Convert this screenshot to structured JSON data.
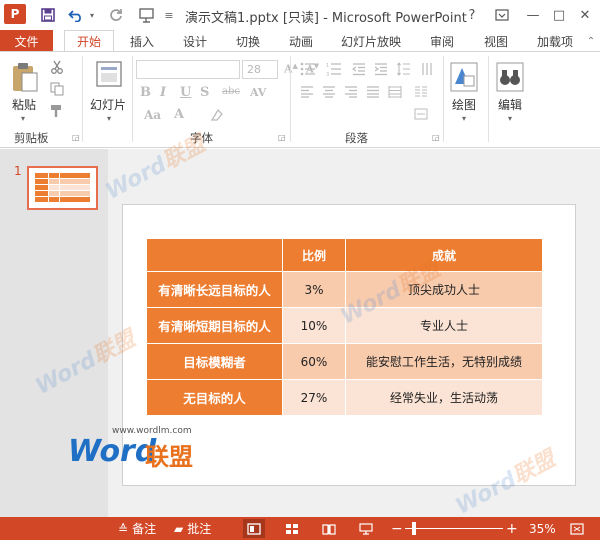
{
  "window": {
    "title": "演示文稿1.pptx [只读] - Microsoft PowerPoint",
    "app_icon_letter": "P",
    "help": "?",
    "controls": [
      "—",
      "□",
      "✕"
    ]
  },
  "ribbon": {
    "tabs": [
      {
        "label": "文件",
        "state": "file"
      },
      {
        "label": "开始",
        "state": "active"
      },
      {
        "label": "插入"
      },
      {
        "label": "设计"
      },
      {
        "label": "切换"
      },
      {
        "label": "动画"
      },
      {
        "label": "幻灯片放映"
      },
      {
        "label": "审阅"
      },
      {
        "label": "视图"
      },
      {
        "label": "加载项"
      }
    ],
    "groups": {
      "clipboard": {
        "label": "剪贴板",
        "paste": "粘贴"
      },
      "slides": {
        "label": "",
        "new_slide": "幻灯片"
      },
      "font": {
        "label": "字体",
        "font_size": "28",
        "buttons": [
          "B",
          "I",
          "U",
          "S",
          "abc",
          "AV",
          "Aa",
          "A"
        ]
      },
      "paragraph": {
        "label": "段落"
      },
      "drawing": {
        "label": "",
        "draw": "绘图"
      },
      "editing": {
        "label": "",
        "edit": "编辑"
      }
    }
  },
  "thumbnails": {
    "slide_number": "1"
  },
  "table": {
    "headers": [
      "",
      "比例",
      "成就"
    ],
    "rows": [
      {
        "label": "有清晰长远目标的人",
        "ratio": "3%",
        "achievement": "顶尖成功人士"
      },
      {
        "label": "有清晰短期目标的人",
        "ratio": "10%",
        "achievement": "专业人士"
      },
      {
        "label": "目标模糊者",
        "ratio": "60%",
        "achievement": "能安慰工作生活，无特别成绩"
      },
      {
        "label": "无目标的人",
        "ratio": "27%",
        "achievement": "经常失业，生活动荡"
      }
    ]
  },
  "watermark": {
    "word": "Word",
    "cn": "联盟",
    "url": "www.wordlm.com"
  },
  "statusbar": {
    "notes": "备注",
    "comments": "批注",
    "zoom": "35%",
    "zoom_minus": "−",
    "zoom_plus": "+",
    "zoom_fraction": 0.35
  },
  "colors": {
    "accent": "#d24726",
    "table_header": "#ed7d31",
    "table_odd": "#f8cbad",
    "table_even": "#fbe4d5"
  }
}
